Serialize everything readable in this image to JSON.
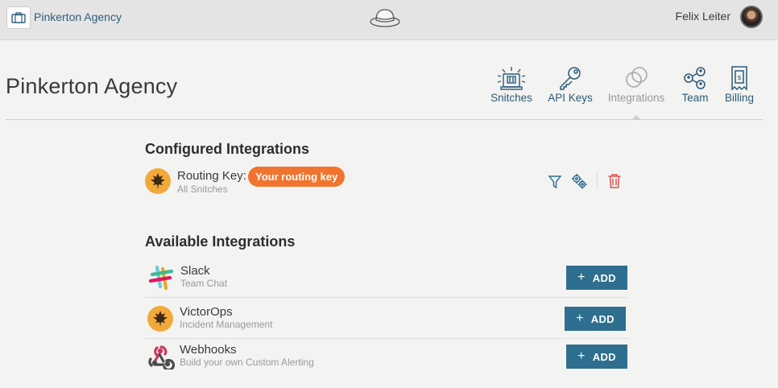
{
  "topbar": {
    "org_name": "Pinkerton Agency",
    "user_name": "Felix Leiter"
  },
  "header": {
    "title": "Pinkerton Agency",
    "nav": [
      {
        "label": "Snitches",
        "icon": "snitch-light-icon",
        "active": false
      },
      {
        "label": "API Keys",
        "icon": "key-icon",
        "active": false
      },
      {
        "label": "Integrations",
        "icon": "integrations-rings-icon",
        "active": true
      },
      {
        "label": "Team",
        "icon": "team-icon",
        "active": false
      },
      {
        "label": "Billing",
        "icon": "receipt-icon",
        "active": false
      }
    ]
  },
  "configured": {
    "title": "Configured Integrations",
    "items": [
      {
        "name": "Routing Key:",
        "badge": "Your routing key",
        "subtitle": "All Snitches",
        "logo": "victorops-leaf-icon"
      }
    ]
  },
  "available": {
    "title": "Available Integrations",
    "items": [
      {
        "name": "Slack",
        "subtitle": "Team Chat",
        "logo": "slack-icon",
        "button": "ADD"
      },
      {
        "name": "VictorOps",
        "subtitle": "Incident Management",
        "logo": "victorops-leaf-icon",
        "button": "ADD"
      },
      {
        "name": "Webhooks",
        "subtitle": "Build your own Custom Alerting",
        "logo": "webhooks-icon",
        "button": "ADD"
      }
    ]
  },
  "colors": {
    "accent": "#2e6e8e",
    "badge": "#f0742e",
    "victorops": "#f2a93b",
    "delete": "#d9534f"
  }
}
